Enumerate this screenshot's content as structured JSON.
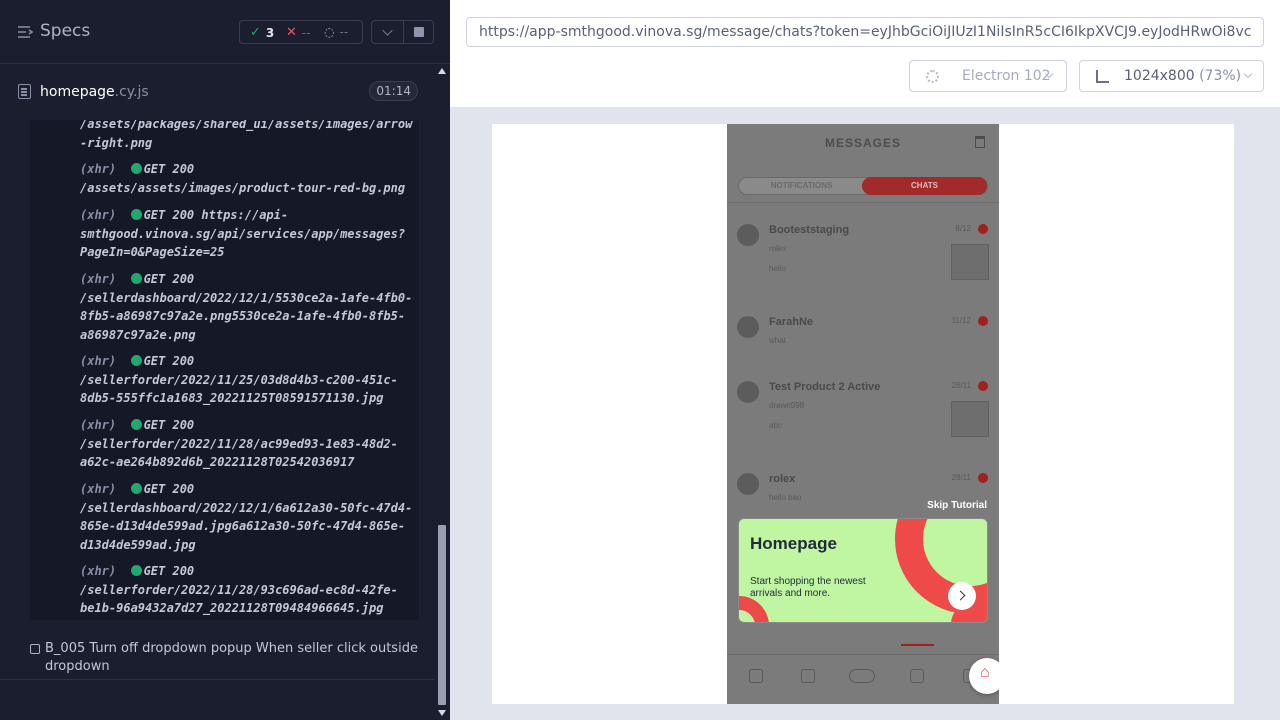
{
  "reporter": {
    "title": "Specs",
    "stats": {
      "passed": "3",
      "failed": "--",
      "pending": "--"
    },
    "spec": {
      "name": "homepage",
      "ext": ".cy.js",
      "duration": "01:14"
    },
    "log": [
      {
        "prefix": "",
        "text": "/assets/packages/shared_ui/assets/images/arrow\n-right.png"
      },
      {
        "prefix": "(xhr)",
        "method": "GET 200",
        "text": "/assets/assets/images/product-tour-red-bg.png"
      },
      {
        "prefix": "(xhr)",
        "method": "GET 200",
        "text": "https://api-\nsmthgood.vinova.sg/api/services/app/messages?\nPageIn=0&PageSize=25"
      },
      {
        "prefix": "(xhr)",
        "method": "GET 200",
        "text": "/sellerdashboard/2022/12/1/5530ce2a-1afe-4fb0-\n8fb5-a86987c97a2e.png5530ce2a-1afe-4fb0-8fb5-\na86987c97a2e.png"
      },
      {
        "prefix": "(xhr)",
        "method": "GET 200",
        "text": "/sellerforder/2022/11/25/03d8d4b3-c200-451c-\n8db5-555ffc1a1683_20221125T08591571130.jpg"
      },
      {
        "prefix": "(xhr)",
        "method": "GET 200",
        "text": "/sellerforder/2022/11/28/ac99ed93-1e83-48d2-\na62c-ae264b892d6b_20221128T02542036917"
      },
      {
        "prefix": "(xhr)",
        "method": "GET 200",
        "text": "/sellerdashboard/2022/12/1/6a612a30-50fc-47d4-\n865e-d13d4de599ad.jpg6a612a30-50fc-47d4-865e-\nd13d4de599ad.jpg"
      },
      {
        "prefix": "(xhr)",
        "method": "GET 200",
        "text": "/sellerforder/2022/11/28/93c696ad-ec8d-42fe-\nbe1b-96a9432a7d27_20221128T09484966645.jpg"
      }
    ],
    "next_test": "B_005 Turn off dropdown popup When seller click outside dropdown"
  },
  "runner": {
    "url": "https://app-smthgood.vinova.sg/message/chats?token=eyJhbGciOiJIUzI1NiIsInR5cCI6IkpXVCJ9.eyJodHRwOi8vc",
    "browser": "Electron 102",
    "viewport": "1024x800",
    "zoom": "(73%)"
  },
  "app": {
    "title": "MESSAGES",
    "tabs": [
      "NOTIFICATIONS",
      "CHATS"
    ],
    "chats": [
      {
        "name": "Booteststaging",
        "line1": "rolex",
        "line2": "hello",
        "date": "8/12"
      },
      {
        "name": "FarahNe",
        "line1": "what",
        "line2": "",
        "date": "11/12"
      },
      {
        "name": "Test Product 2 Active",
        "line1": "drawn998",
        "line2": "abc",
        "date": "28/11"
      },
      {
        "name": "rolex",
        "line1": "hello bao",
        "line2": "",
        "date": "28/11"
      }
    ],
    "skip": "Skip Tutorial",
    "card": {
      "title": "Homepage",
      "subtitle": "Start shopping the newest arrivals and more."
    }
  }
}
